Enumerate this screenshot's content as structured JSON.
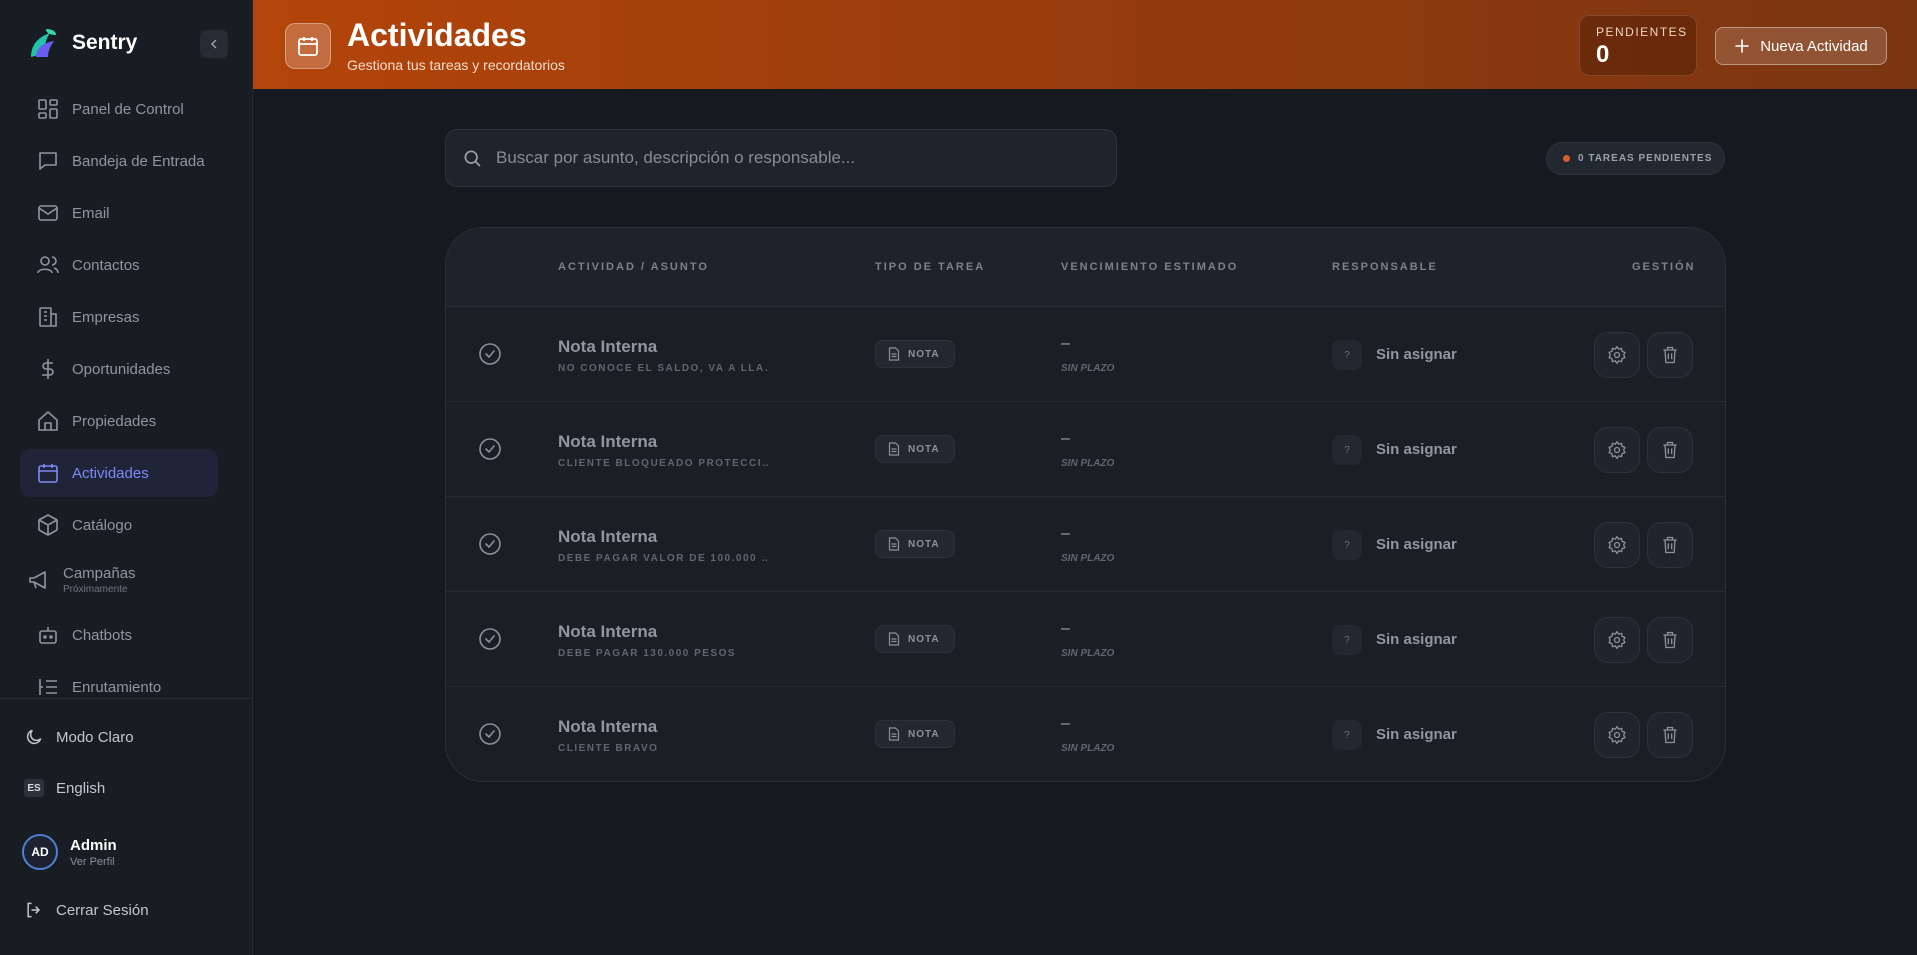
{
  "sidebar": {
    "brand": "Sentry",
    "items": [
      {
        "label": "Panel de Control",
        "icon": "dashboard-icon"
      },
      {
        "label": "Bandeja de Entrada",
        "icon": "inbox-icon"
      },
      {
        "label": "Email",
        "icon": "mail-icon"
      },
      {
        "label": "Contactos",
        "icon": "users-icon"
      },
      {
        "label": "Empresas",
        "icon": "building-icon"
      },
      {
        "label": "Oportunidades",
        "icon": "dollar-icon"
      },
      {
        "label": "Propiedades",
        "icon": "home-icon"
      },
      {
        "label": "Actividades",
        "icon": "calendar-icon",
        "active": true
      },
      {
        "label": "Catálogo",
        "icon": "box-icon"
      },
      {
        "label": "Campañas",
        "sub": "Próximamente",
        "icon": "megaphone-icon"
      },
      {
        "label": "Chatbots",
        "icon": "bot-icon"
      },
      {
        "label": "Enrutamiento",
        "icon": "routing-icon"
      }
    ],
    "footer": {
      "theme_label": "Modo Claro",
      "lang_badge": "ES",
      "lang_label": "English",
      "user_initials": "AD",
      "user_name": "Admin",
      "user_sub": "Ver Perfil",
      "logout_label": "Cerrar Sesión"
    }
  },
  "header": {
    "title": "Actividades",
    "subtitle": "Gestiona tus tareas y recordatorios",
    "pending_label": "PENDIENTES",
    "pending_count": "0",
    "new_button": "Nueva Actividad"
  },
  "search": {
    "placeholder": "Buscar por asunto, descripción o responsable..."
  },
  "pending_pill": "0 TAREAS PENDIENTES",
  "table": {
    "headers": {
      "activity": "ACTIVIDAD / ASUNTO",
      "type": "TIPO DE TAREA",
      "due": "VENCIMIENTO ESTIMADO",
      "owner": "RESPONSABLE",
      "manage": "GESTIÓN"
    },
    "rows": [
      {
        "title": "Nota Interna",
        "desc": "NO CONOCE EL SALDO, VA A LLA…",
        "type": "NOTA",
        "due": "–",
        "due_sub": "SIN PLAZO",
        "owner_avatar": "?",
        "owner": "Sin asignar"
      },
      {
        "title": "Nota Interna",
        "desc": "CLIENTE BLOQUEADO PROTECCI…",
        "type": "NOTA",
        "due": "–",
        "due_sub": "SIN PLAZO",
        "owner_avatar": "?",
        "owner": "Sin asignar"
      },
      {
        "title": "Nota Interna",
        "desc": "DEBE PAGAR VALOR DE 100.000 …",
        "type": "NOTA",
        "due": "–",
        "due_sub": "SIN PLAZO",
        "owner_avatar": "?",
        "owner": "Sin asignar"
      },
      {
        "title": "Nota Interna",
        "desc": "DEBE PAGAR 130.000 PESOS",
        "type": "NOTA",
        "due": "–",
        "due_sub": "SIN PLAZO",
        "owner_avatar": "?",
        "owner": "Sin asignar"
      },
      {
        "title": "Nota Interna",
        "desc": "CLIENTE BRAVO",
        "type": "NOTA",
        "due": "–",
        "due_sub": "SIN PLAZO",
        "owner_avatar": "?",
        "owner": "Sin asignar"
      }
    ]
  },
  "colors": {
    "accent": "#7c8bf5",
    "header_gradient_start": "#b4450a",
    "header_gradient_end": "#7a3511",
    "background": "#161a20"
  }
}
